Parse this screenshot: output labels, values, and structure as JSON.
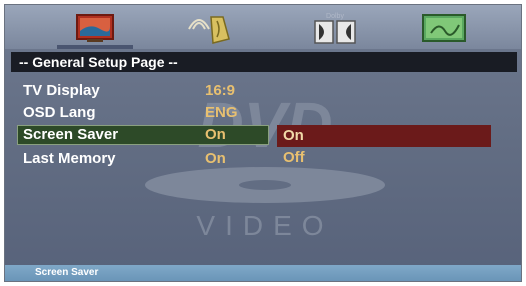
{
  "header": {
    "title": "-- General Setup Page --"
  },
  "tabs": [
    {
      "name": "general-setup",
      "icon": "tv-picture-icon",
      "active": true
    },
    {
      "name": "audio-setup",
      "icon": "speaker-hand-icon",
      "active": false
    },
    {
      "name": "dolby-setup",
      "icon": "dolby-icon",
      "active": false,
      "label": "Dolby"
    },
    {
      "name": "preference-setup",
      "icon": "preference-icon",
      "active": false
    }
  ],
  "settings": [
    {
      "label": "TV Display",
      "value": "16:9"
    },
    {
      "label": "OSD Lang",
      "value": "ENG"
    },
    {
      "label": "Screen Saver",
      "value": "On",
      "selected": true
    },
    {
      "label": "Last Memory",
      "value": "On"
    }
  ],
  "options": [
    {
      "label": "On",
      "active": true
    },
    {
      "label": "Off",
      "active": false
    }
  ],
  "watermark": {
    "logo": "DVD",
    "text": "VIDEO"
  },
  "status": {
    "text": "Screen Saver"
  },
  "colors": {
    "accent": "#e8c070",
    "selection": "#2d4a28",
    "option_highlight": "#6b1a1a",
    "header_bg": "#191c24"
  }
}
